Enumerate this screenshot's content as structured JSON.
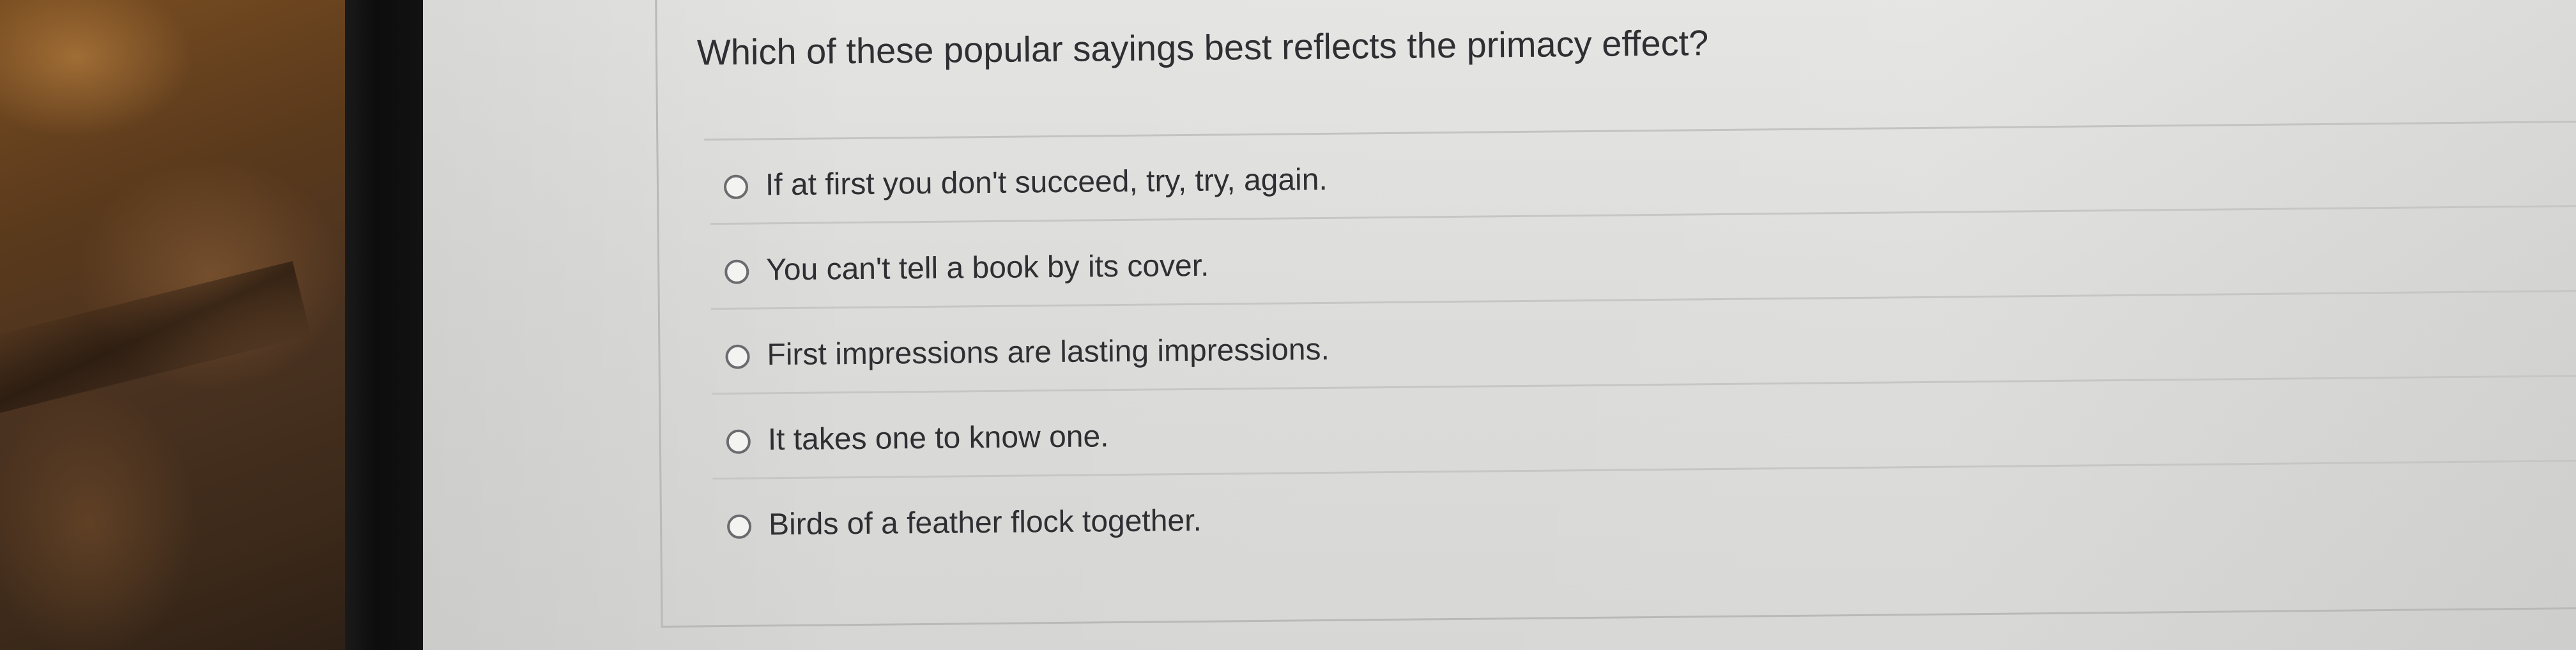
{
  "question": {
    "text": "Which of these popular sayings best reflects the primacy effect?"
  },
  "options": [
    {
      "label": "If at first you don't succeed, try, try, again."
    },
    {
      "label": "You can't tell a book by its cover."
    },
    {
      "label": "First impressions are lasting impressions."
    },
    {
      "label": "It takes one to know one."
    },
    {
      "label": "Birds of a feather flock together."
    }
  ],
  "colors": {
    "screen_background": "#dcdcda",
    "text": "#2f2f33",
    "radio_border": "#6b6b6f",
    "divider": "#c6c6c4",
    "bezel": "#111111"
  }
}
